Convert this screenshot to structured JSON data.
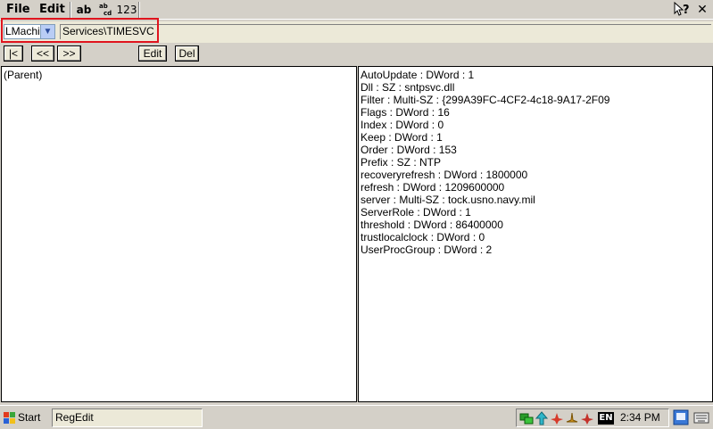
{
  "menubar": {
    "file_label": "File",
    "edit_label": "Edit",
    "tool_ab": "ab",
    "tool_123": "123",
    "help_label": "?",
    "close_label": "✕"
  },
  "pathbar": {
    "root_key": "LMachine",
    "path": "Services\\TIMESVC"
  },
  "nav": {
    "first": "|<",
    "prev": "<<",
    "next": ">>",
    "edit": "Edit",
    "del": "Del"
  },
  "left_pane": {
    "items": [
      "(Parent)"
    ]
  },
  "right_pane": {
    "values": [
      "AutoUpdate : DWord : 1",
      "Dll : SZ : sntpsvc.dll",
      "Filter : Multi-SZ : {299A39FC-4CF2-4c18-9A17-2F09",
      "Flags : DWord : 16",
      "Index : DWord : 0",
      "Keep : DWord : 1",
      "Order : DWord : 153",
      "Prefix : SZ : NTP",
      "recoveryrefresh : DWord : 1800000",
      "refresh : DWord : 1209600000",
      "server : Multi-SZ : tock.usno.navy.mil",
      "ServerRole : DWord : 1",
      "threshold : DWord : 86400000",
      "trustlocalclock : DWord : 0",
      "UserProcGroup : DWord : 2"
    ]
  },
  "taskbar": {
    "start_label": "Start",
    "task_label": "RegEdit",
    "lang": "EN",
    "clock": "2:34 PM"
  },
  "colors": {
    "highlight_box": "#e0141e",
    "chrome": "#d4d0c8"
  }
}
